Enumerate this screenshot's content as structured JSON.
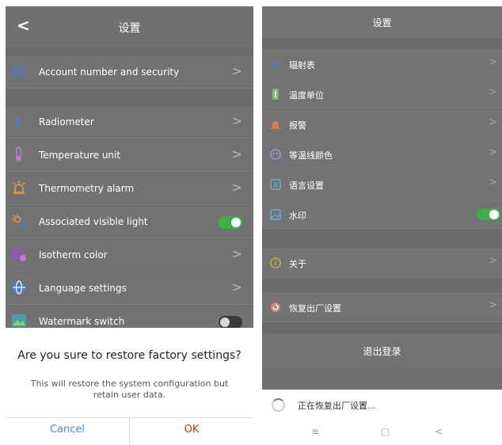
{
  "left": {
    "header": {
      "back_icon": "chevron-left-icon",
      "back_glyph": "<",
      "title": "设置"
    },
    "items": [
      {
        "id": "account",
        "label": "Account number and security",
        "icon": "user-circle-icon",
        "control": "chevron"
      },
      {
        "id": "radiometer",
        "label": "Radiometer",
        "icon": "epsilon-icon",
        "control": "chevron"
      },
      {
        "id": "temp-unit",
        "label": "Temperature unit",
        "icon": "thermometer-icon",
        "control": "chevron"
      },
      {
        "id": "alarm",
        "label": "Thermometry alarm",
        "icon": "alarm-icon",
        "control": "chevron"
      },
      {
        "id": "visible-light",
        "label": "Associated visible light",
        "icon": "sun-gear-icon",
        "control": "toggle",
        "on": true
      },
      {
        "id": "isotherm",
        "label": "Isotherm color",
        "icon": "palette-icon",
        "control": "chevron"
      },
      {
        "id": "language",
        "label": "Language settings",
        "icon": "globe-icon",
        "control": "chevron"
      },
      {
        "id": "watermark",
        "label": "Watermark switch",
        "icon": "image-icon",
        "control": "toggle",
        "on": false
      }
    ],
    "chevron_glyph": ">",
    "dialog": {
      "title": "Are you sure to restore factory settings?",
      "message": "This will restore the system configuration but retain user data.",
      "cancel": "Cancel",
      "ok": "OK"
    }
  },
  "right": {
    "header": {
      "title": "设置"
    },
    "items": [
      {
        "id": "radiometer",
        "label": "辐射表",
        "icon": "epsilon-icon",
        "control": "chevron"
      },
      {
        "id": "temp-unit",
        "label": "温度单位",
        "icon": "thermometer-icon",
        "control": "chevron"
      },
      {
        "id": "alarm",
        "label": "报警",
        "icon": "alarm-icon",
        "control": "chevron"
      },
      {
        "id": "isotherm",
        "label": "等温线颜色",
        "icon": "palette-icon",
        "control": "chevron"
      },
      {
        "id": "language",
        "label": "语言设置",
        "icon": "language-icon",
        "control": "chevron"
      },
      {
        "id": "watermark",
        "label": "水印",
        "icon": "image-icon",
        "control": "toggle",
        "on": true
      },
      {
        "id": "about",
        "label": "关于",
        "icon": "info-icon",
        "control": "chevron"
      },
      {
        "id": "factory-reset",
        "label": "恢复出厂设置",
        "icon": "reset-icon",
        "control": "chevron"
      }
    ],
    "chevron_glyph": ">",
    "logout": "退出登录",
    "progress": {
      "text": "正在恢复出厂设置..."
    },
    "nav": {
      "menu_glyph": "≡",
      "home_glyph": "▢",
      "back_glyph": "<"
    }
  },
  "colors": {
    "toggle_on": "#3cb04a",
    "toggle_off": "#3a3a3a",
    "accent_blue": "#3a8ee6",
    "accent_red": "#e02020"
  }
}
